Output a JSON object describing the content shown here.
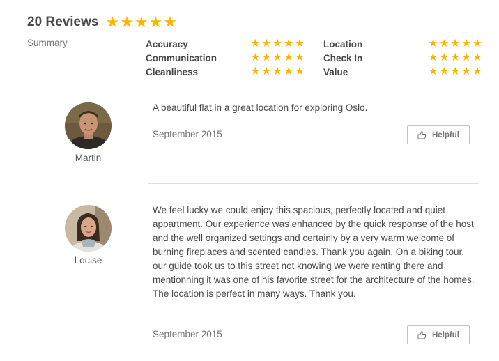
{
  "header": {
    "title": "20 Reviews",
    "overall_rating": 5,
    "star_color": "#ffb400"
  },
  "summary": {
    "label": "Summary",
    "categories_left": [
      {
        "label": "Accuracy",
        "rating": 5
      },
      {
        "label": "Communication",
        "rating": 5
      },
      {
        "label": "Cleanliness",
        "rating": 5
      }
    ],
    "categories_right": [
      {
        "label": "Location",
        "rating": 5
      },
      {
        "label": "Check In",
        "rating": 5
      },
      {
        "label": "Value",
        "rating": 5
      }
    ]
  },
  "reviews": [
    {
      "reviewer": "Martin",
      "text": "A beautiful flat in a great location for exploring Oslo.",
      "date": "September 2015",
      "helpful_label": "Helpful"
    },
    {
      "reviewer": "Louise",
      "text": "We feel lucky we could enjoy this spacious, perfectly located and quiet appartment. Our experience was enhanced by the quick response of the host and the well organized settings and certainly by a very warm welcome of burning fireplaces and scented candles. Thank you again. On a biking tour, our guide took us to this street not knowing we were renting there and mentionning it was one of his favorite street for the architecture of the homes. The location is perfect in many ways. Thank you.",
      "date": "September 2015",
      "helpful_label": "Helpful"
    }
  ]
}
